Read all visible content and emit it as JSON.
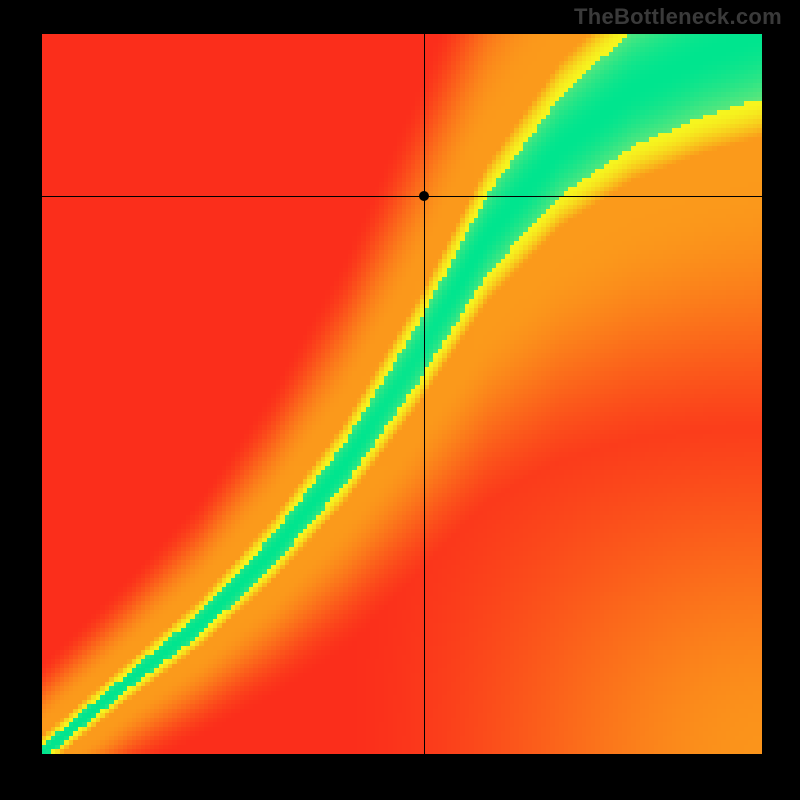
{
  "watermark": "TheBottleneck.com",
  "plot": {
    "grid_n": 160,
    "x_range": [
      0,
      1
    ],
    "y_range": [
      0,
      1
    ]
  },
  "crosshair": {
    "x_frac": 0.53,
    "y_frac": 0.775
  },
  "marker": {
    "x_frac": 0.53,
    "y_frac": 0.775,
    "radius_px": 5
  },
  "colors": {
    "full_red": "#fb2e1b",
    "orange": "#fb9a1b",
    "yellow": "#f6f61f",
    "green_edge": "#9fe86f",
    "green_core": "#00e58f",
    "black": "#000000"
  },
  "ridge": {
    "knots_x": [
      0.0,
      0.12,
      0.22,
      0.32,
      0.42,
      0.52,
      0.62,
      0.72,
      0.82,
      0.92,
      1.0
    ],
    "knots_y": [
      0.0,
      0.1,
      0.18,
      0.28,
      0.4,
      0.55,
      0.72,
      0.84,
      0.92,
      0.97,
      1.0
    ],
    "width_green": [
      0.01,
      0.012,
      0.016,
      0.022,
      0.03,
      0.042,
      0.058,
      0.072,
      0.085,
      0.094,
      0.1
    ],
    "width_yellow": [
      0.04,
      0.046,
      0.056,
      0.072,
      0.092,
      0.118,
      0.15,
      0.178,
      0.2,
      0.216,
      0.228
    ]
  },
  "side_bias": 0.9,
  "chart_data": {
    "type": "heatmap",
    "title": "",
    "xlabel": "",
    "ylabel": "",
    "xlim": [
      0,
      1
    ],
    "ylim": [
      0,
      1
    ],
    "annotations": [
      "TheBottleneck.com"
    ],
    "marker": {
      "x": 0.53,
      "y": 0.775
    },
    "crosshair": {
      "x": 0.53,
      "y": 0.775
    },
    "optimal_curve": {
      "description": "green ridge center line; y as a function of x on [0,1]",
      "x": [
        0.0,
        0.12,
        0.22,
        0.32,
        0.42,
        0.52,
        0.62,
        0.72,
        0.82,
        0.92,
        1.0
      ],
      "y": [
        0.0,
        0.1,
        0.18,
        0.28,
        0.4,
        0.55,
        0.72,
        0.84,
        0.92,
        0.97,
        1.0
      ]
    },
    "band_half_widths": {
      "green": [
        0.01,
        0.012,
        0.016,
        0.022,
        0.03,
        0.042,
        0.058,
        0.072,
        0.085,
        0.094,
        0.1
      ],
      "yellow": [
        0.04,
        0.046,
        0.056,
        0.072,
        0.092,
        0.118,
        0.15,
        0.178,
        0.2,
        0.216,
        0.228
      ]
    },
    "color_scale": {
      "0.00": "#fb2e1b",
      "0.40": "#fb9a1b",
      "0.72": "#f6f61f",
      "0.90": "#9fe86f",
      "1.00": "#00e58f"
    }
  }
}
